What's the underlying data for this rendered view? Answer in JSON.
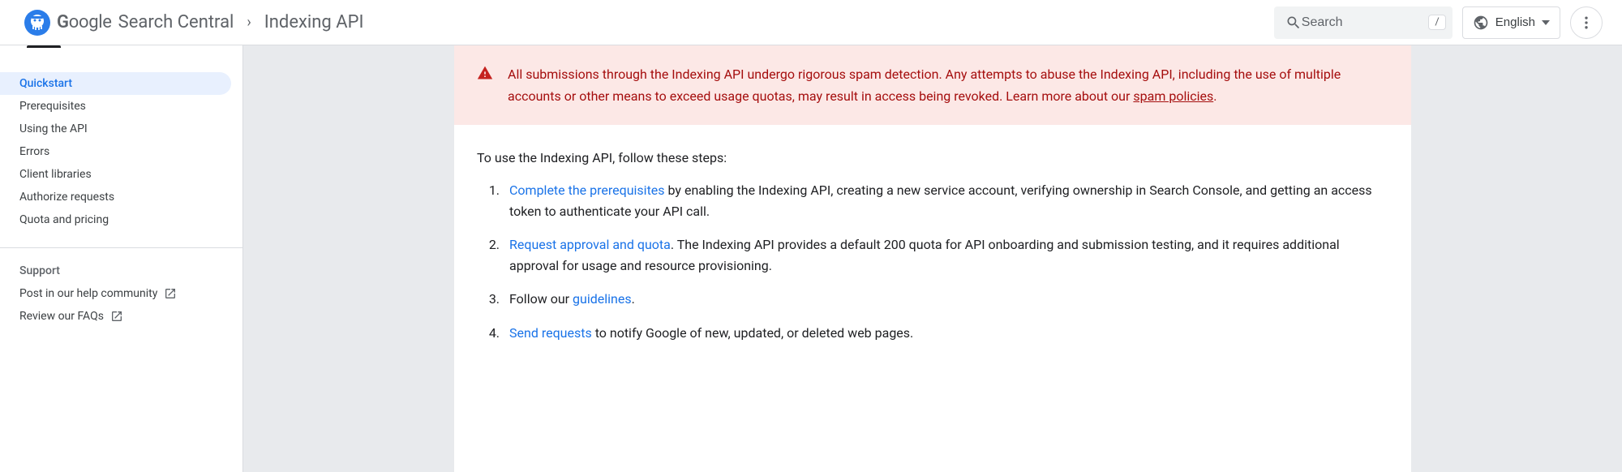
{
  "header": {
    "brand_prefix": "G",
    "brand_rest": "oogle",
    "section": "Search Central",
    "breadcrumb_page": "Indexing API",
    "search_placeholder": "Search",
    "search_shortcut": "/",
    "language": "English"
  },
  "sidebar": {
    "items": [
      {
        "label": "Quickstart",
        "active": true
      },
      {
        "label": "Prerequisites",
        "active": false
      },
      {
        "label": "Using the API",
        "active": false
      },
      {
        "label": "Errors",
        "active": false
      },
      {
        "label": "Client libraries",
        "active": false
      },
      {
        "label": "Authorize requests",
        "active": false
      },
      {
        "label": "Quota and pricing",
        "active": false
      }
    ],
    "support": {
      "title": "Support",
      "items": [
        {
          "label": "Post in our help community",
          "external": true
        },
        {
          "label": "Review our FAQs",
          "external": true
        }
      ]
    }
  },
  "alert": {
    "text_before_link": "All submissions through the Indexing API undergo rigorous spam detection. Any attempts to abuse the Indexing API, including the use of multiple accounts or other means to exceed usage quotas, may result in access being revoked. Learn more about our ",
    "link_text": "spam policies",
    "text_after_link": "."
  },
  "content": {
    "intro": "To use the Indexing API, follow these steps:",
    "steps": [
      {
        "link": "Complete the prerequisites",
        "rest": " by enabling the Indexing API, creating a new service account, verifying ownership in Search Console, and getting an access token to authenticate your API call."
      },
      {
        "link": "Request approval and quota",
        "rest": ". The Indexing API provides a default 200 quota for API onboarding and submission testing, and it requires additional approval for usage and resource provisioning."
      },
      {
        "prefix": "Follow our ",
        "link": "guidelines",
        "rest": "."
      },
      {
        "link": "Send requests",
        "rest": " to notify Google of new, updated, or deleted web pages."
      }
    ]
  }
}
